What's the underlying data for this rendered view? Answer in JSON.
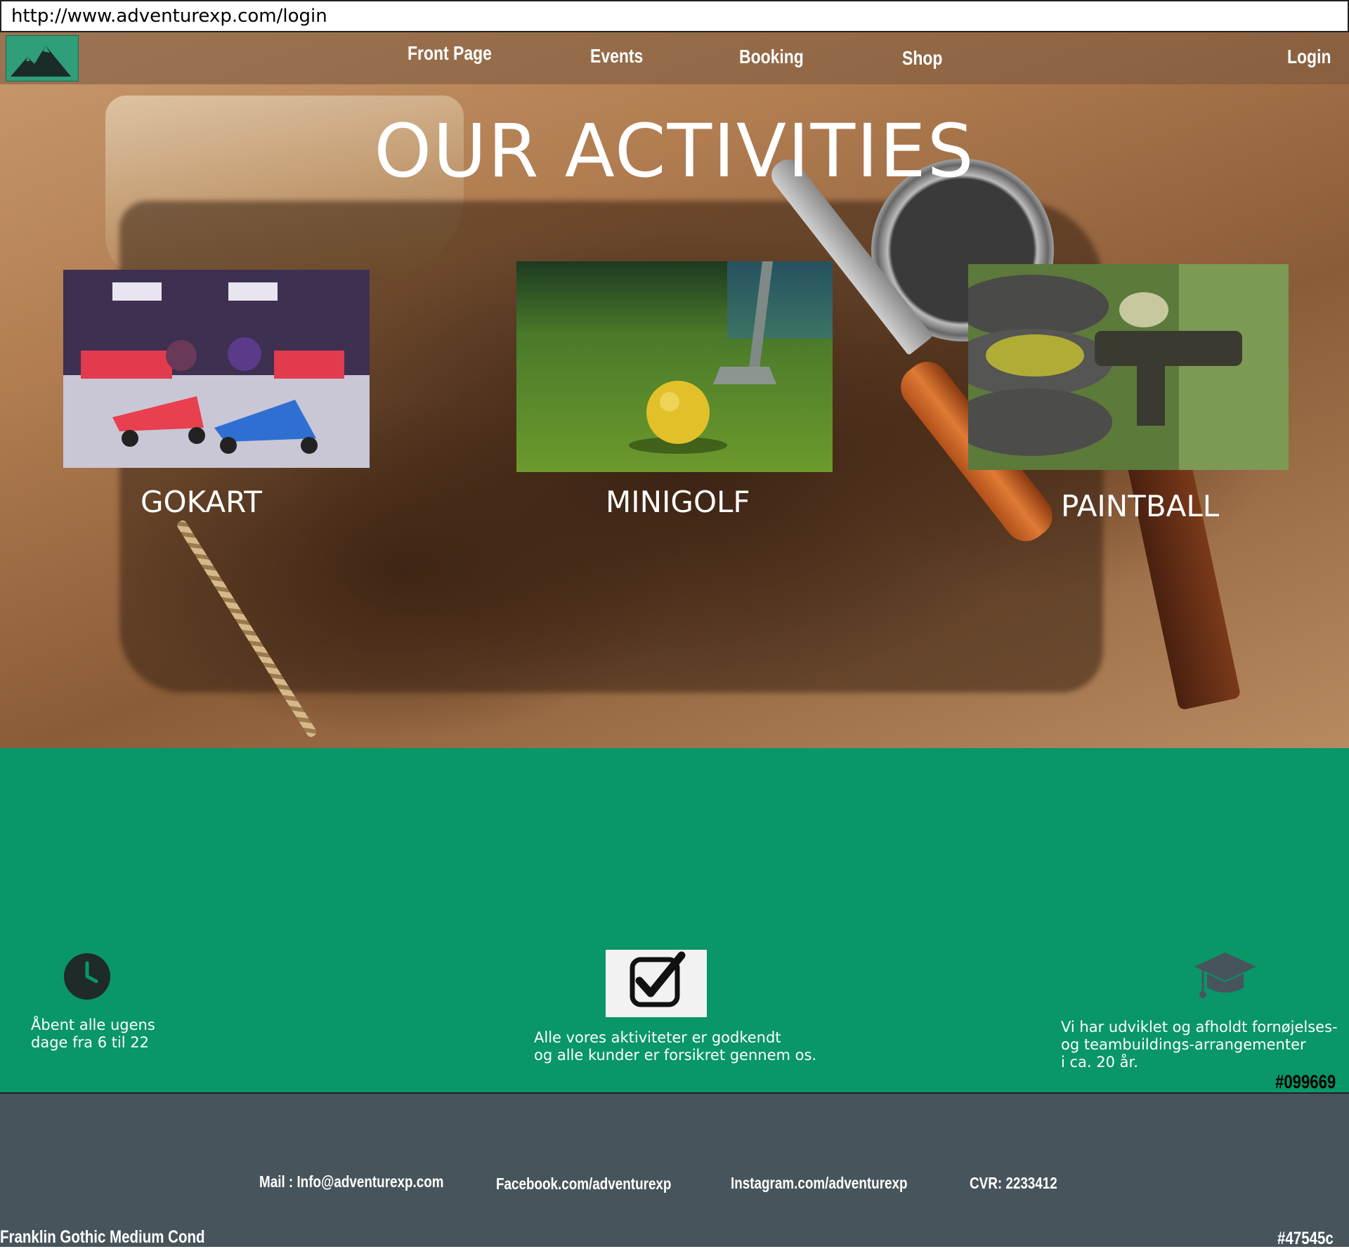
{
  "browser": {
    "url": "http://www.adventurexp.com/login"
  },
  "nav": {
    "logo_icon": "mountain-logo-icon",
    "items": [
      "Front Page",
      "Events",
      "Booking",
      "Shop"
    ],
    "login": "Login"
  },
  "hero": {
    "title": "OUR ACTIVITIES",
    "activities": [
      {
        "label": "GOKART",
        "image": "gokart-illustration"
      },
      {
        "label": "MINIGOLF",
        "image": "minigolf-photo"
      },
      {
        "label": "PAINTBALL",
        "image": "paintball-photo"
      }
    ]
  },
  "features": {
    "items": [
      {
        "icon": "clock-icon",
        "text": "Åbent alle ugens\ndage fra 6 til 22"
      },
      {
        "icon": "checkbox-icon",
        "text": "Alle vores aktiviteter er godkendt\nog alle kunder er forsikret gennem os."
      },
      {
        "icon": "graduation-cap-icon",
        "text": "Vi har udviklet og afholdt fornøjelses-\nog teambuildings-arrangementer\ni ca. 20 år."
      }
    ],
    "color_note": "#099669"
  },
  "footer": {
    "mail": "Mail : Info@adventurexp.com",
    "facebook": "Facebook.com/adventurexp",
    "instagram": "Instagram.com/adventurexp",
    "cvr": "CVR: 2233412",
    "font_note": "Franklin Gothic Medium Cond",
    "color_note": "#47545c"
  },
  "colors": {
    "green_band": "#099669",
    "footer": "#47545c",
    "logo_bg": "#2f9e79"
  }
}
